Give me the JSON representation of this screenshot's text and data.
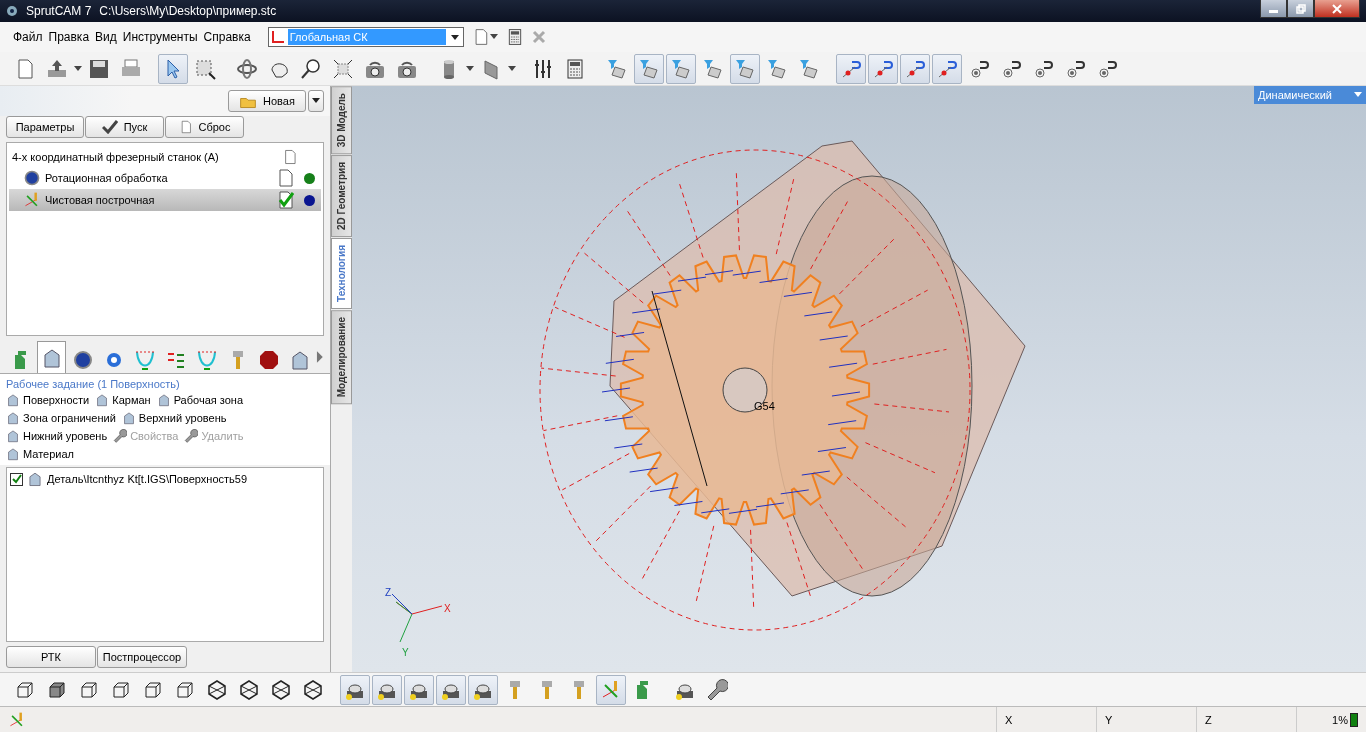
{
  "window": {
    "title": "SprutCAM 7",
    "path": "C:\\Users\\My\\Desktop\\пример.stc"
  },
  "menu": [
    "Файл",
    "Правка",
    "Вид",
    "Инструменты",
    "Справка"
  ],
  "coordinate_system": "Глобальная СК",
  "main_toolbar": [
    {
      "pressed": false
    },
    {
      "pressed": false
    },
    {
      "pressed": false
    },
    {
      "pressed": false
    },
    {
      "pressed": true
    },
    {
      "pressed": false
    },
    {
      "pressed": false
    },
    {
      "pressed": false
    },
    {
      "pressed": false
    },
    {
      "pressed": false
    },
    {
      "pressed": false
    },
    {
      "pressed": false
    },
    {
      "pressed": false
    },
    {
      "pressed": false
    },
    {
      "pressed": false
    },
    {
      "pressed": false
    },
    {
      "pressed": false
    },
    {
      "pressed": true
    },
    {
      "pressed": true
    },
    {
      "pressed": false
    },
    {
      "pressed": true
    },
    {
      "pressed": false
    },
    {
      "pressed": false
    },
    {
      "pressed": true
    },
    {
      "pressed": true
    },
    {
      "pressed": true
    },
    {
      "pressed": true
    },
    {
      "pressed": false
    },
    {
      "pressed": false
    },
    {
      "pressed": false
    },
    {
      "pressed": false
    },
    {
      "pressed": false
    }
  ],
  "new_button": "Новая",
  "action_buttons": [
    "Параметры",
    "Пуск",
    "Сброс"
  ],
  "operations_tree": {
    "label": "4-х координатный фрезерный станок (А)",
    "children": [
      {
        "label": "Ротационная обработка",
        "selected": false,
        "checked": false,
        "color": "#16801a"
      },
      {
        "label": "Чистовая построчная",
        "selected": true,
        "checked": true,
        "color": "#0a1590"
      }
    ]
  },
  "side_tabs": [
    {
      "label": "3D Модель",
      "selected": false
    },
    {
      "label": "2D Геометрия",
      "selected": false
    },
    {
      "label": "Технология",
      "selected": true
    },
    {
      "label": "Моделирование",
      "selected": false
    }
  ],
  "operation_tabs": [
    {
      "selected": false
    },
    {
      "selected": true
    },
    {
      "selected": false
    },
    {
      "selected": false
    },
    {
      "selected": false
    },
    {
      "selected": false
    },
    {
      "selected": false
    },
    {
      "selected": false
    },
    {
      "selected": false
    },
    {
      "selected": false
    }
  ],
  "job": {
    "title": "Рабочее задание  (1 Поверхность)",
    "actions": [
      {
        "label": "Поверхности",
        "disabled": false
      },
      {
        "label": "Карман",
        "disabled": false
      },
      {
        "label": "Рабочая зона",
        "disabled": false
      },
      {
        "label": "Зона ограничений",
        "disabled": false
      },
      {
        "label": "Верхний уровень",
        "disabled": false
      },
      {
        "label": "Нижний уровень",
        "disabled": false
      },
      {
        "label": "Свойства",
        "disabled": true
      },
      {
        "label": "Удалить",
        "disabled": true
      },
      {
        "label": "Материал",
        "disabled": false
      }
    ],
    "items": [
      {
        "label": "Деталь\\Itcnthyz Kt[t.IGS\\Поверхность59",
        "checked": true
      }
    ]
  },
  "bottom_tabs": [
    "РТК",
    "Постпроцессор"
  ],
  "viewport": {
    "view_mode": "Динамический",
    "origin_label": "G54",
    "axes": [
      "X",
      "Y",
      "Z"
    ]
  },
  "bottom_toolbar": [
    {
      "pressed": false
    },
    {
      "pressed": false
    },
    {
      "pressed": false
    },
    {
      "pressed": false
    },
    {
      "pressed": false
    },
    {
      "pressed": false
    },
    {
      "pressed": false
    },
    {
      "pressed": false
    },
    {
      "pressed": false
    },
    {
      "pressed": false
    },
    {
      "pressed": true
    },
    {
      "pressed": true
    },
    {
      "pressed": true
    },
    {
      "pressed": true
    },
    {
      "pressed": true
    },
    {
      "pressed": false
    },
    {
      "pressed": false
    },
    {
      "pressed": false
    },
    {
      "pressed": true
    },
    {
      "pressed": false
    },
    {
      "pressed": false
    },
    {
      "pressed": false
    }
  ],
  "status_bar": {
    "fields": [
      "X",
      "Y",
      "Z"
    ],
    "progress": "1%"
  }
}
